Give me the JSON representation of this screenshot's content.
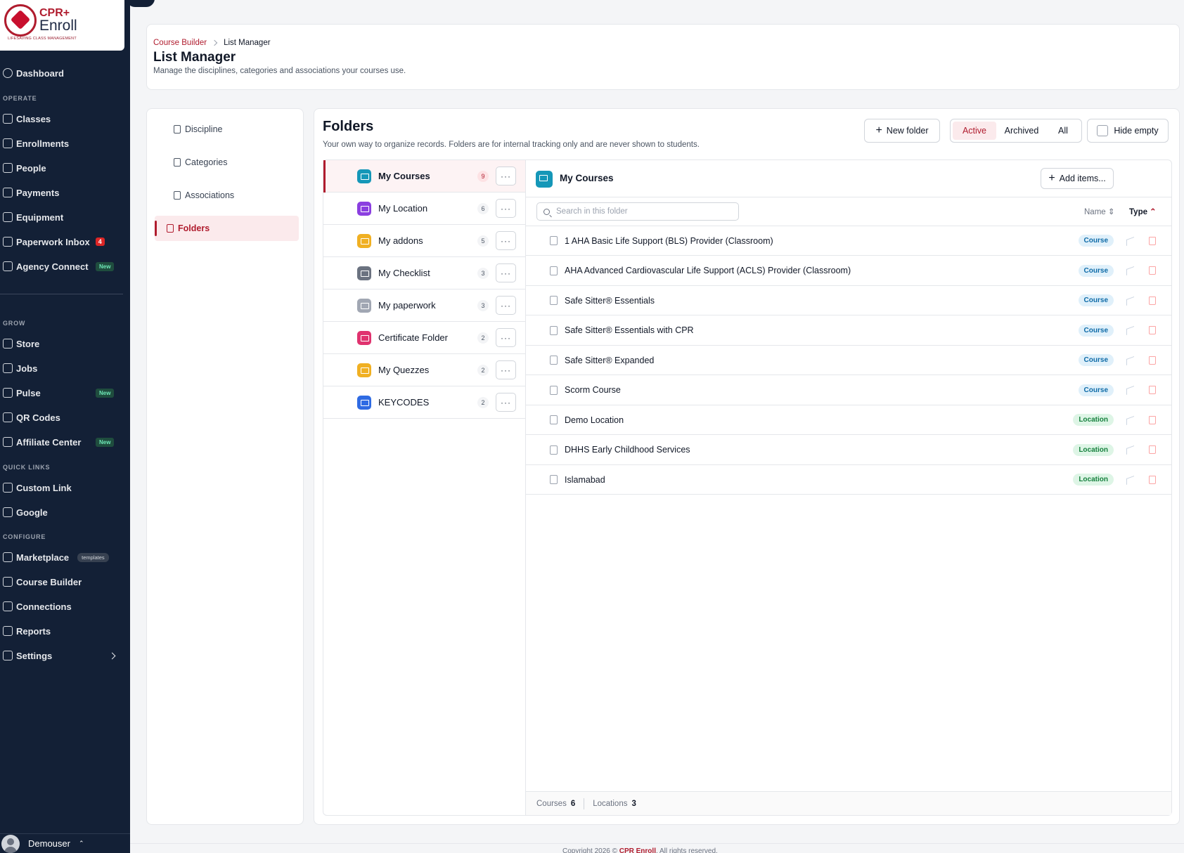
{
  "brand": {
    "line1": "CPR+",
    "line2": "Enroll",
    "tagline": "LIFESAVING CLASS MANAGEMENT"
  },
  "sidebar": {
    "dashboard": "Dashboard",
    "sections": {
      "operate": "OPERATE",
      "grow": "GROW",
      "quick_links": "QUICK LINKS",
      "configure": "CONFIGURE"
    },
    "operate": [
      {
        "label": "Classes",
        "icon": "book-icon"
      },
      {
        "label": "Enrollments",
        "icon": "user-icon"
      },
      {
        "label": "People",
        "icon": "people-icon"
      },
      {
        "label": "Payments",
        "icon": "payments-icon"
      },
      {
        "label": "Equipment",
        "icon": "equipment-icon"
      },
      {
        "label": "Paperwork Inbox",
        "icon": "inbox-icon",
        "badge": "4"
      },
      {
        "label": "Agency Connect",
        "icon": "connect-icon",
        "badge": "New"
      }
    ],
    "grow": [
      {
        "label": "Store",
        "icon": "cart-icon"
      },
      {
        "label": "Jobs",
        "icon": "briefcase-icon"
      },
      {
        "label": "Pulse",
        "icon": "heart-pulse-icon",
        "badge": "New"
      },
      {
        "label": "QR Codes",
        "icon": "qr-icon"
      },
      {
        "label": "Affiliate Center",
        "icon": "handshake-icon",
        "badge": "New"
      }
    ],
    "quick_links": [
      {
        "label": "Custom Link",
        "icon": "link-icon"
      },
      {
        "label": "Google",
        "icon": "link-icon"
      }
    ],
    "configure": [
      {
        "label": "Marketplace",
        "icon": "store-icon",
        "badge": "templates"
      },
      {
        "label": "Course Builder",
        "icon": "graduation-cap-icon"
      },
      {
        "label": "Connections",
        "icon": "plug-icon"
      },
      {
        "label": "Reports",
        "icon": "report-icon"
      },
      {
        "label": "Settings",
        "icon": "gear-icon"
      }
    ],
    "user": "Demouser"
  },
  "header": {
    "breadcrumb": [
      "Course Builder",
      "List Manager"
    ],
    "title": "List Manager",
    "subtitle": "Manage the disciplines, categories and associations your courses use."
  },
  "subnav": [
    {
      "label": "Discipline",
      "active": false
    },
    {
      "label": "Categories",
      "active": false
    },
    {
      "label": "Associations",
      "active": false
    },
    {
      "label": "Folders",
      "active": true
    }
  ],
  "folders": {
    "title": "Folders",
    "subtitle": "Your own way to organize records. Folders are for internal tracking only and are never shown to students.",
    "new_folder": "New folder",
    "filters": [
      "Active",
      "Archived",
      "All"
    ],
    "active_filter": "Active",
    "hide_empty": "Hide empty",
    "list": [
      {
        "name": "My Courses",
        "count": "9",
        "color": "#1597b8",
        "active": true
      },
      {
        "name": "My Location",
        "count": "6",
        "color": "#8b3fe0"
      },
      {
        "name": "My addons",
        "count": "5",
        "color": "#f0b023"
      },
      {
        "name": "My Checklist",
        "count": "3",
        "color": "#6b7280"
      },
      {
        "name": "My paperwork",
        "count": "3",
        "color": "#a1a7b3"
      },
      {
        "name": "Certificate Folder",
        "count": "2",
        "color": "#e0336f"
      },
      {
        "name": "My Quezzes",
        "count": "2",
        "color": "#f0b023"
      },
      {
        "name": "KEYCODES",
        "count": "2",
        "color": "#2f6be3"
      }
    ]
  },
  "detail": {
    "title": "My Courses",
    "add_items": "Add items...",
    "search_placeholder": "Search in this folder",
    "sort_name": "Name",
    "sort_type": "Type",
    "items": [
      {
        "name": "1 AHA Basic Life Support (BLS) Provider (Classroom)",
        "type": "Course"
      },
      {
        "name": "AHA Advanced Cardiovascular Life Support (ACLS) Provider (Classroom)",
        "type": "Course"
      },
      {
        "name": "Safe Sitter® Essentials",
        "type": "Course"
      },
      {
        "name": "Safe Sitter® Essentials with CPR",
        "type": "Course"
      },
      {
        "name": "Safe Sitter® Expanded",
        "type": "Course"
      },
      {
        "name": "Scorm Course",
        "type": "Course"
      },
      {
        "name": "Demo Location",
        "type": "Location"
      },
      {
        "name": "DHHS Early Childhood Services",
        "type": "Location"
      },
      {
        "name": "Islamabad",
        "type": "Location"
      }
    ],
    "footer": {
      "courses_label": "Courses",
      "courses_count": "6",
      "locations_label": "Locations",
      "locations_count": "3"
    }
  },
  "copyright": {
    "prefix": "Copyright 2026 ©",
    "brand": "CPR Enroll",
    "suffix": ". All rights reserved."
  },
  "colors": {
    "accent": "#b01c2e",
    "sidebar_bg": "#132036"
  }
}
